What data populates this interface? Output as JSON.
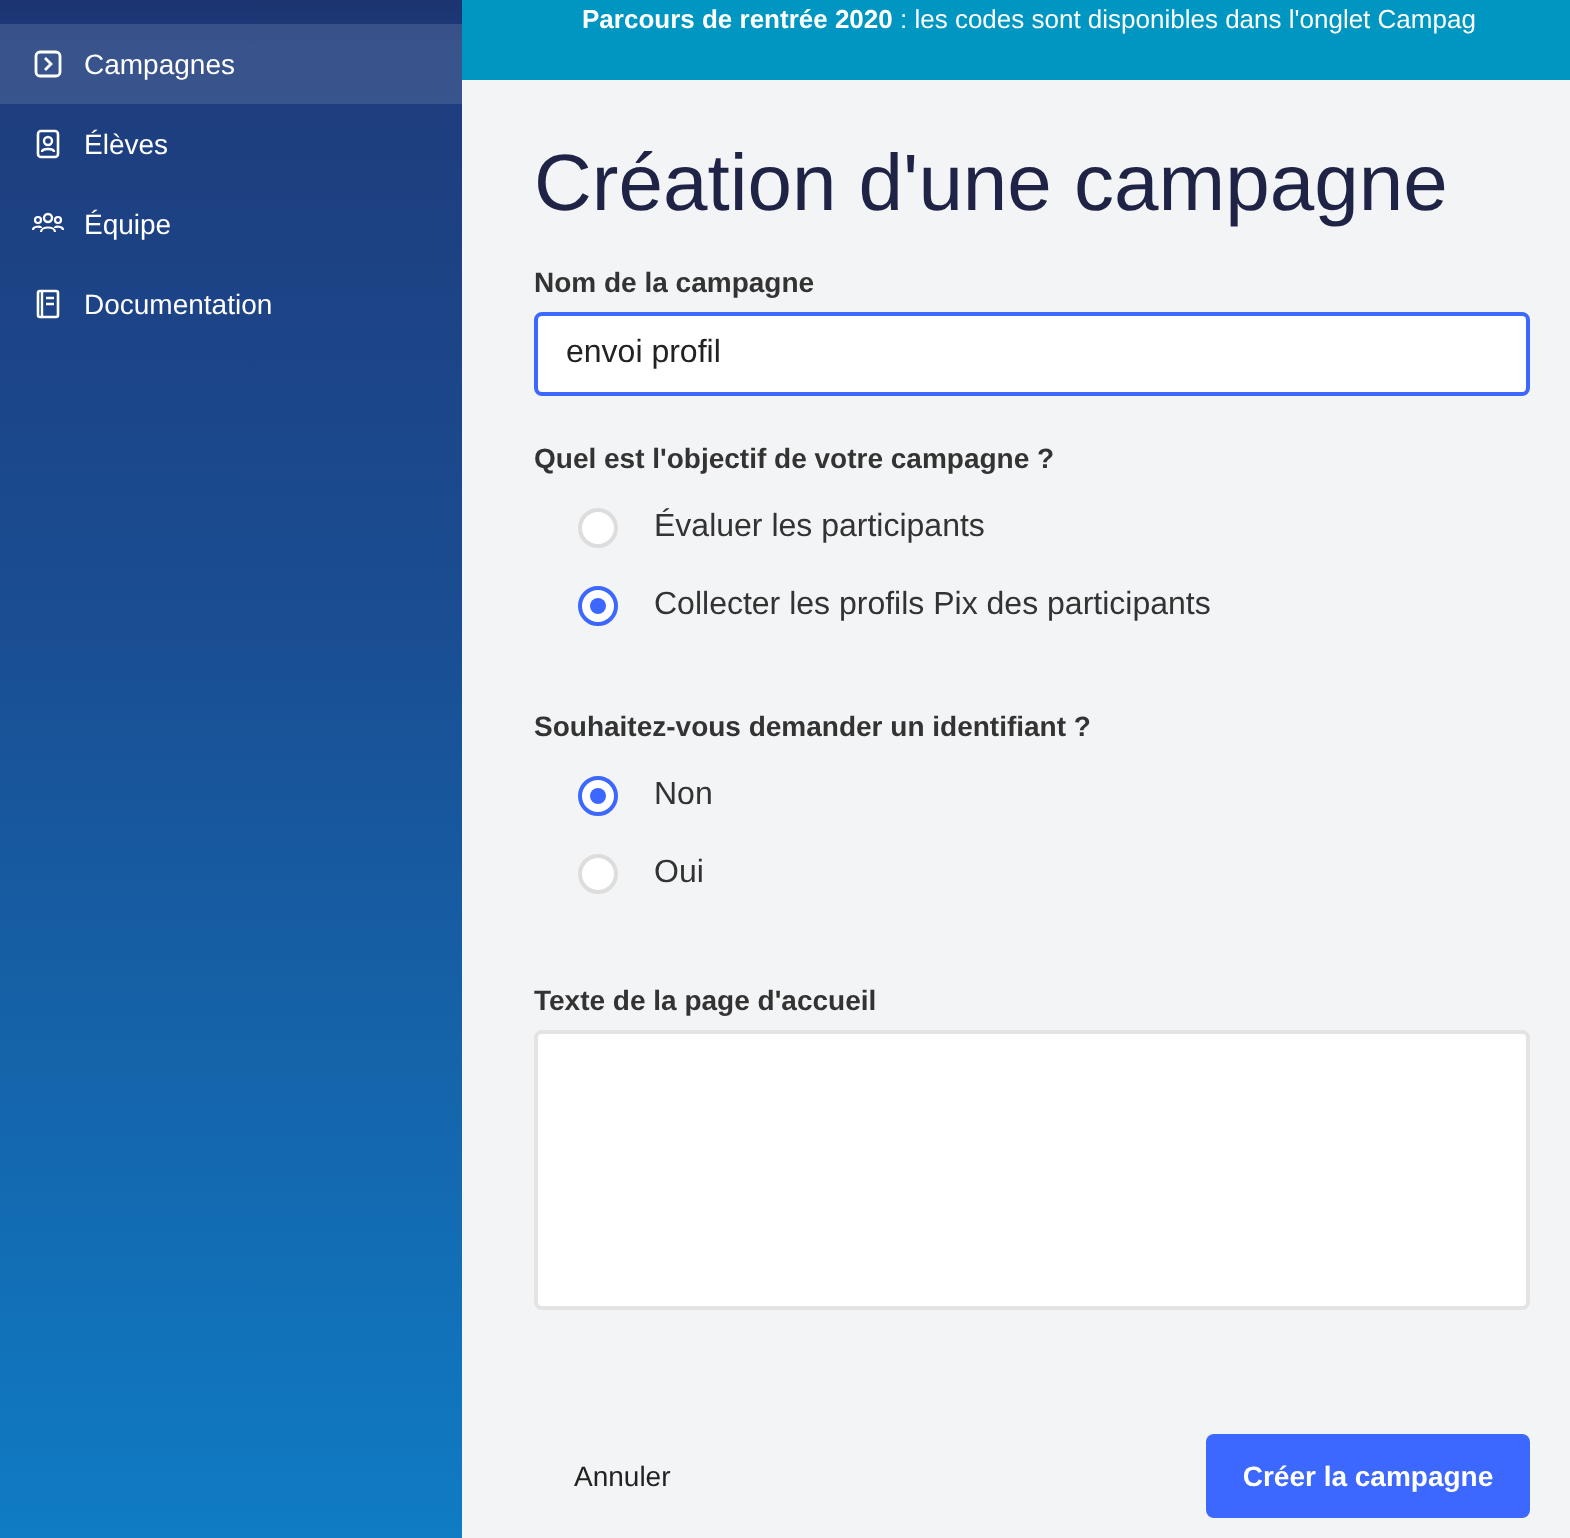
{
  "sidebar": {
    "items": [
      {
        "label": "Campagnes",
        "selected": true
      },
      {
        "label": "Élèves",
        "selected": false
      },
      {
        "label": "Équipe",
        "selected": false
      },
      {
        "label": "Documentation",
        "selected": false
      }
    ]
  },
  "banner": {
    "text": "**Parcours de rentrée 2020** : les codes sont disponibles dans l'onglet Campag"
  },
  "title": "Création d'une campagne",
  "name_field": {
    "label": "Nom de la campagne",
    "value": "envoi profil"
  },
  "groups": [
    {
      "question": "Quel est l'objectif de votre campagne ?",
      "options": [
        {
          "label": "Évaluer les participants",
          "selected": false
        },
        {
          "label": "Collecter les profils Pix des participants",
          "selected": true
        }
      ]
    },
    {
      "question": "Souhaitez-vous demander un identifiant ?",
      "options": [
        {
          "label": "Non",
          "selected": true
        },
        {
          "label": "Oui",
          "selected": false
        }
      ]
    }
  ],
  "welcome_field": {
    "label": "Texte de la page d'accueil"
  },
  "buttons": {
    "cancel": "Annuler",
    "submit": "Créer la campagne"
  }
}
